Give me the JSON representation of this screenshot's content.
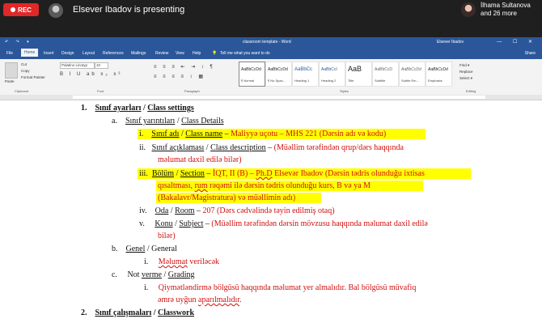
{
  "zoom": {
    "rec_label": "REC",
    "presenter_text": "Elsever Ibadov is presenting",
    "participant_name": "İlhama Sultanova",
    "participant_more": "and 26 more"
  },
  "word": {
    "title": "classroom template - Word",
    "user": "Elsever Ibadov",
    "quick_access": "↶ ↷ ▾",
    "window_controls": "— ☐ ✕",
    "menu": [
      "File",
      "Home",
      "Insert",
      "Design",
      "Layout",
      "References",
      "Mailings",
      "Review",
      "View",
      "Help"
    ],
    "tell_me": "Tell me what you want to do",
    "share": "Share",
    "ribbon": {
      "cut": "Cut",
      "copy": "Copy",
      "format_painter": "Format Painter",
      "paste": "Paste",
      "font_name": "Palatino Linotyp",
      "font_size": "10",
      "format_buttons": "B I U ab x₂ x²",
      "para_buttons_1": "≡ ≡ ≡ ⇤ ⇥ ↕ ¶",
      "para_buttons_2": "≡ ≡ ≡ ≡ ↕ ▦",
      "styles": [
        {
          "preview": "AaBbCcDd",
          "name": "¶ Normal"
        },
        {
          "preview": "AaBbCcDd",
          "name": "¶ No Spac..."
        },
        {
          "preview": "AaBbCc",
          "name": "Heading 1"
        },
        {
          "preview": "AaBbCcI",
          "name": "Heading 2"
        },
        {
          "preview": "AaB",
          "name": "Title"
        },
        {
          "preview": "AaBbCcD",
          "name": "Subtitle"
        },
        {
          "preview": "AaBbCcDd",
          "name": "Subtle Em..."
        },
        {
          "preview": "AaBbCcDd",
          "name": "Emphasis"
        }
      ],
      "find": "Find ▾",
      "replace": "Replace",
      "select": "Select ▾",
      "group_clipboard": "Clipboard",
      "group_font": "Font",
      "group_paragraph": "Paragraph",
      "group_styles": "Styles",
      "group_editing": "Editing"
    }
  },
  "doc": {
    "l1_num": "1.",
    "l1_a": "Sınıf ayarları",
    "l1_sep": " / ",
    "l1_b": "Class settings",
    "a_num": "a.",
    "a_a": "Sınıf yarıntıları",
    "a_sep": " / ",
    "a_b": "Class Details",
    "i_num": "i.",
    "i_a": "Sınıf adı",
    "i_sep": " / ",
    "i_b": "Class name",
    "i_dash": " – ",
    "i_red": "Maliyyə uçotu – MHS 221 (Dərsin adı və kodu)",
    "ii_num": "ii.",
    "ii_a": "Sınıf açıklaması",
    "ii_sep": " / ",
    "ii_b": "Class description",
    "ii_dash": " – ",
    "ii_red1": "(Müəllim tərəfindən qrup/dərs haqqında",
    "ii_red2": "məlumat daxil edilə bilər)",
    "iii_num": "iii.",
    "iii_a": "Bölüm",
    "iii_sep": " / ",
    "iii_b": "Section",
    "iii_dash": " – ",
    "iii_red1a": "İQT, II (B) – ",
    "iii_red1b": "Ph.D",
    "iii_red1c": " Elsevər Ibadov (Dərsin tədris olunduğu ixtisas",
    "iii_red2a": "qısaltması, ",
    "iii_red2b": "rum",
    "iii_red2c": " rəqəmi ilə dərsin tədris olunduğu kurs, B və ya M",
    "iii_red3": "(Bakalavr/Magistratura) və müəllimin adı)",
    "iv_num": "iv.",
    "iv_a": "Oda",
    "iv_sep": " / ",
    "iv_b": "Room",
    "iv_dash": " – ",
    "iv_red": "207 (Dərs cədvəlində təyin edilmiş otaq)",
    "v_num": "v.",
    "v_a": "Konu",
    "v_sep": " / ",
    "v_b": "Subject",
    "v_dash": " – ",
    "v_red1": "(Müəllim tərəfindən dərsin mövzusu haqqında məlumat daxil edilə",
    "v_red2": "bilər)",
    "b_num": "b.",
    "b_a": "Genel",
    "b_rest": " / General",
    "bi_num": "i.",
    "bi_a": "Məlumat",
    "bi_rest": " veriləcək",
    "c_num": "c.",
    "c_a": "Not ",
    "c_b": "verme",
    "c_sep": " / ",
    "c_c": "Grading",
    "ci_num": "i.",
    "ci_red1": "Qiymətləndirmə bölgüsü haqqında məlumat yer almalıdır. Bal bölgüsü müvafiq",
    "ci_red2a": "əmrə uyğun ",
    "ci_red2b": "aparılmalıdır",
    "ci_red2c": ".",
    "l2_num": "2.",
    "l2_a": "Sınıf çalışmaları",
    "l2_sep": " / ",
    "l2_b": "Classwork"
  }
}
